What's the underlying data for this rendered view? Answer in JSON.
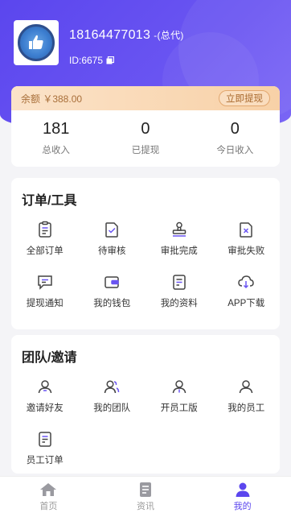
{
  "profile": {
    "phone": "18164477013",
    "role": "-(总代)",
    "id_text": "ID:6675"
  },
  "balance": {
    "label": "余额 ￥388.00",
    "withdraw_label": "立即提现"
  },
  "stats": [
    {
      "value": "181",
      "label": "总收入"
    },
    {
      "value": "0",
      "label": "已提现"
    },
    {
      "value": "0",
      "label": "今日收入"
    }
  ],
  "orders": {
    "title": "订单/工具",
    "items": [
      {
        "label": "全部订单",
        "icon": "clipboard-list-icon"
      },
      {
        "label": "待审核",
        "icon": "check-document-icon"
      },
      {
        "label": "审批完成",
        "icon": "stamp-icon"
      },
      {
        "label": "审批失败",
        "icon": "reject-document-icon"
      },
      {
        "label": "提现通知",
        "icon": "message-icon"
      },
      {
        "label": "我的钱包",
        "icon": "wallet-icon"
      },
      {
        "label": "我的资料",
        "icon": "profile-document-icon"
      },
      {
        "label": "APP下载",
        "icon": "cloud-download-icon"
      }
    ]
  },
  "team": {
    "title": "团队/邀请",
    "items": [
      {
        "label": "邀请好友",
        "icon": "user-icon"
      },
      {
        "label": "我的团队",
        "icon": "team-icon"
      },
      {
        "label": "开员工版",
        "icon": "user-plus-icon"
      },
      {
        "label": "我的员工",
        "icon": "user-outline-icon"
      },
      {
        "label": "员工订单",
        "icon": "staff-order-icon"
      }
    ]
  },
  "tabbar": [
    {
      "label": "首页",
      "icon": "home-icon",
      "active": false
    },
    {
      "label": "资讯",
      "icon": "news-icon",
      "active": false
    },
    {
      "label": "我的",
      "icon": "person-icon",
      "active": true
    }
  ],
  "colors": {
    "primary": "#5b46ee",
    "balance_bar": "#f8d1a7",
    "icon_stroke": "#444444"
  }
}
